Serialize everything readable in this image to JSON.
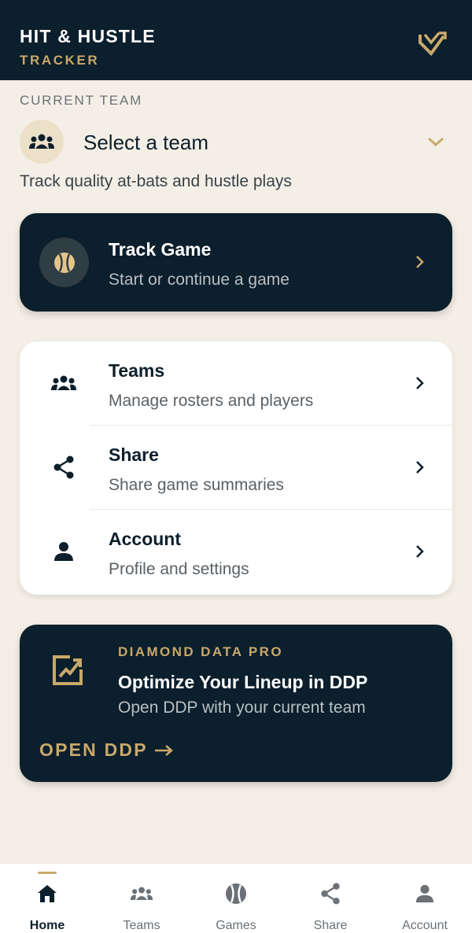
{
  "header": {
    "title": "HIT & HUSTLE",
    "subtitle": "TRACKER",
    "logo_icon": "chart-check-icon"
  },
  "team": {
    "section_label": "CURRENT TEAM",
    "select_label": "Select a team",
    "description": "Track quality at-bats and hustle plays",
    "icon": "group-icon"
  },
  "track_card": {
    "title": "Track Game",
    "subtitle": "Start or continue a game",
    "icon": "baseball-icon"
  },
  "menu": [
    {
      "title": "Teams",
      "subtitle": "Manage rosters and players",
      "icon": "group-icon"
    },
    {
      "title": "Share",
      "subtitle": "Share game summaries",
      "icon": "share-icon"
    },
    {
      "title": "Account",
      "subtitle": "Profile and settings",
      "icon": "person-icon"
    }
  ],
  "promo": {
    "kicker": "DIAMOND DATA PRO",
    "title": "Optimize Your Lineup in DDP",
    "subtitle": "Open DDP with your current team",
    "cta": "OPEN DDP",
    "icon": "edit-chart-icon"
  },
  "bottom_nav": {
    "active": "Home",
    "items": [
      {
        "label": "Home",
        "icon": "home-icon"
      },
      {
        "label": "Teams",
        "icon": "group-icon"
      },
      {
        "label": "Games",
        "icon": "baseball-icon"
      },
      {
        "label": "Share",
        "icon": "share-icon"
      },
      {
        "label": "Account",
        "icon": "person-icon"
      }
    ]
  },
  "colors": {
    "navy": "#0b1f2c",
    "gold": "#c9a86b",
    "background": "#f4efe6"
  }
}
